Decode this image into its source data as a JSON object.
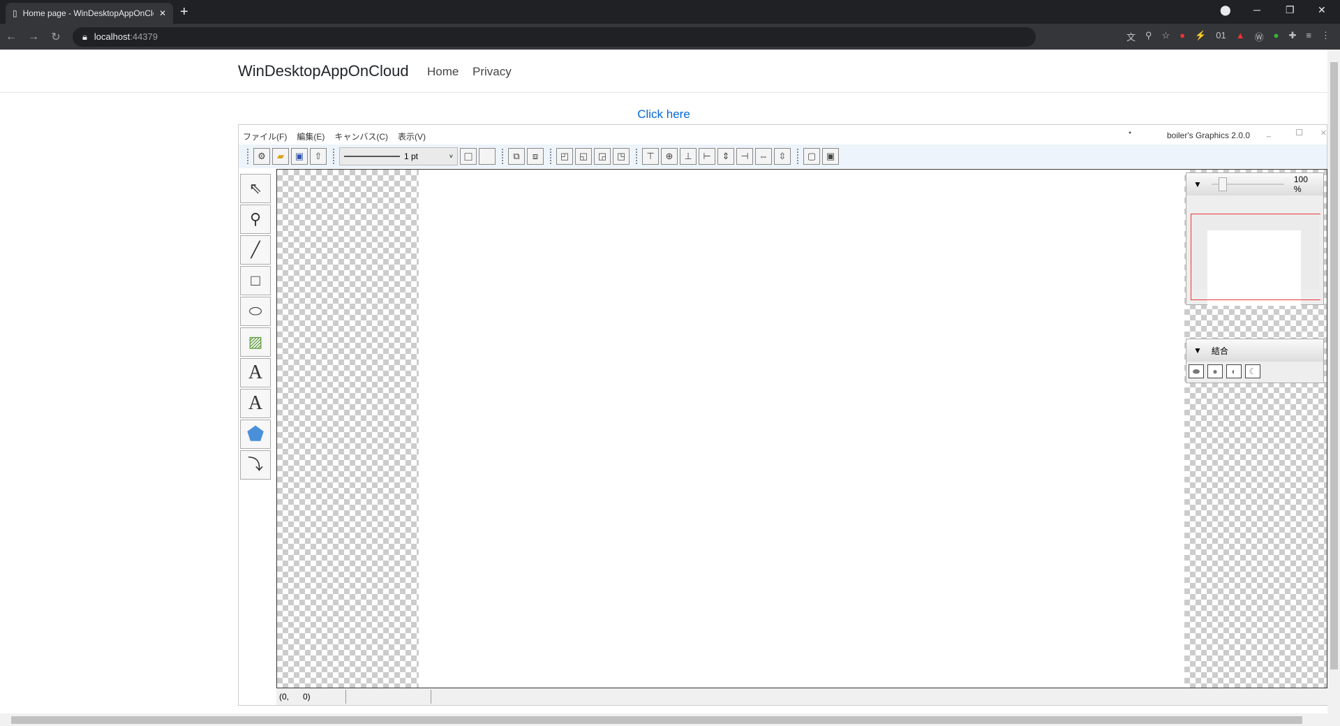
{
  "browser": {
    "tab_title": "Home page - WinDesktopAppOnCloud",
    "url_host": "localhost",
    "url_port": ":44379"
  },
  "site": {
    "brand": "WinDesktopAppOnCloud",
    "nav": [
      "Home",
      "Privacy"
    ],
    "link": "Click here"
  },
  "app": {
    "menu": [
      "ファイル(F)",
      "編集(E)",
      "キャンバス(C)",
      "表示(V)"
    ],
    "modified": "*",
    "title": "boiler's Graphics 2.0.0",
    "line_width": "1 pt",
    "zoom": "100 %",
    "combine_label": "結合",
    "status_coords": "(0,      0)"
  }
}
